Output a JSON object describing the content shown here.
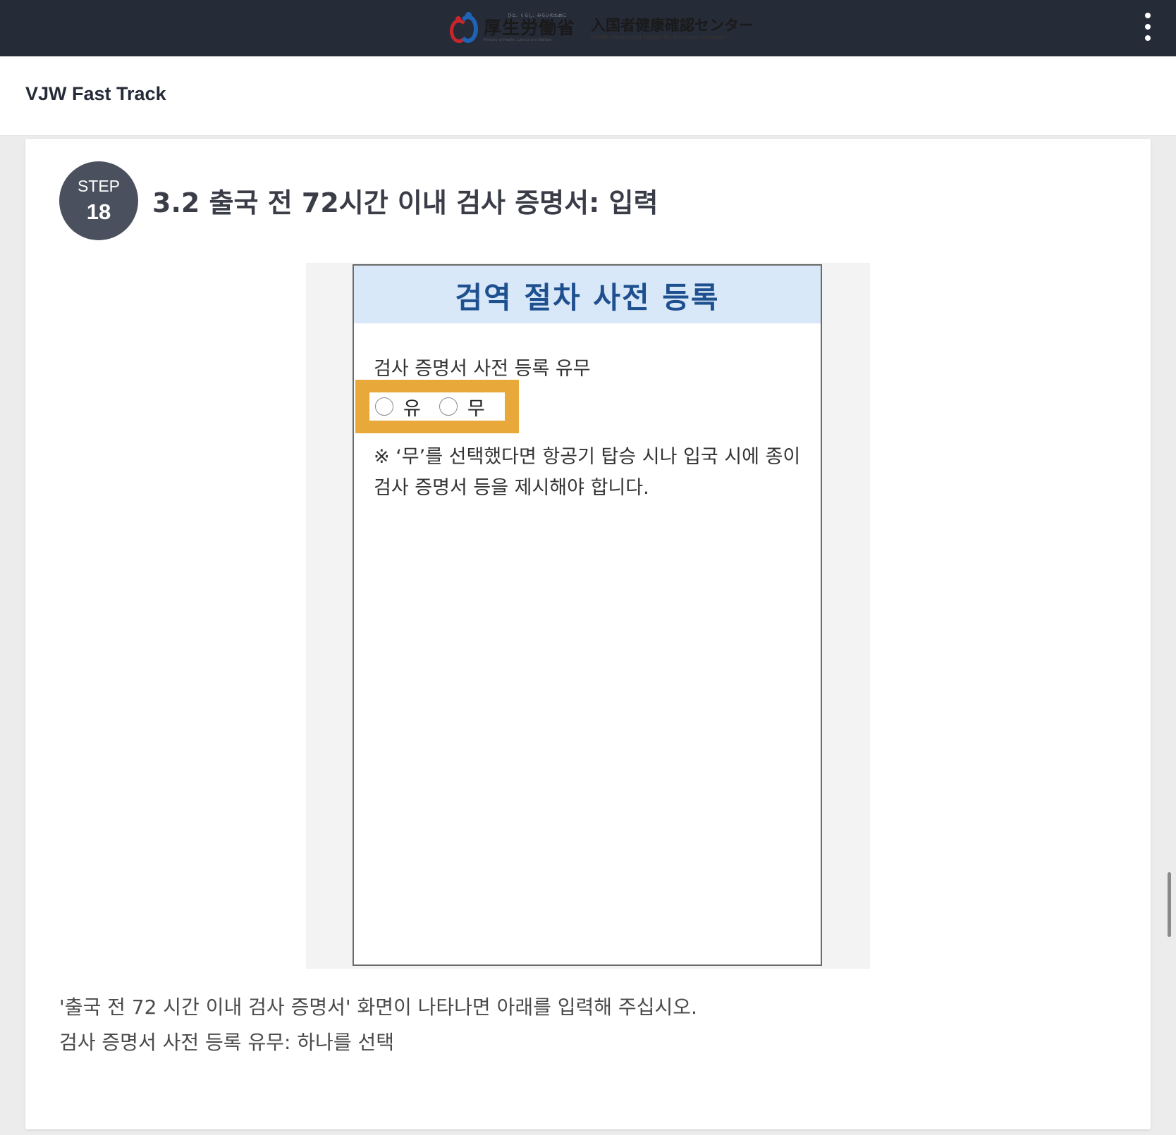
{
  "header": {
    "logo_tagline": "ひと、くらし、みらいのために",
    "logo_ministry": "厚生労働省",
    "logo_ministry_en": "Ministry of Health, Labour and Welfare",
    "logo_center": "入国者健康確認センター",
    "logo_center_en": "Health Monitoring Center for Overseas Entrants",
    "menu_icon": "kebab-menu-icon"
  },
  "nav": {
    "title": "VJW Fast Track"
  },
  "step": {
    "label": "STEP",
    "number": "18",
    "title": "3.2 출국 전 72시간 이내 검사 증명서: 입력"
  },
  "screenshot": {
    "header_title": "검역 절차 사전 등록",
    "question": "검사 증명서 사전 등록 유무",
    "options": [
      {
        "label": "유",
        "selected": false
      },
      {
        "label": "무",
        "selected": false
      }
    ],
    "note": "※ ‘무’를 선택했다면 항공기 탑승 시나 입국 시에 종이 검사 증명서 등을 제시해야 합니다.",
    "highlight_color": "#e8a93a",
    "header_bg": "#d8e8f8"
  },
  "description": {
    "line1": "'출국 전 72 시간 이내 검사 증명서' 화면이 나타나면 아래를 입력해 주십시오.",
    "line2": "검사 증명서 사전 등록 유무: 하나를 선택"
  },
  "colors": {
    "topbar": "#262b38",
    "step_circle": "#4b505e",
    "title_blue": "#1e4f8e"
  }
}
